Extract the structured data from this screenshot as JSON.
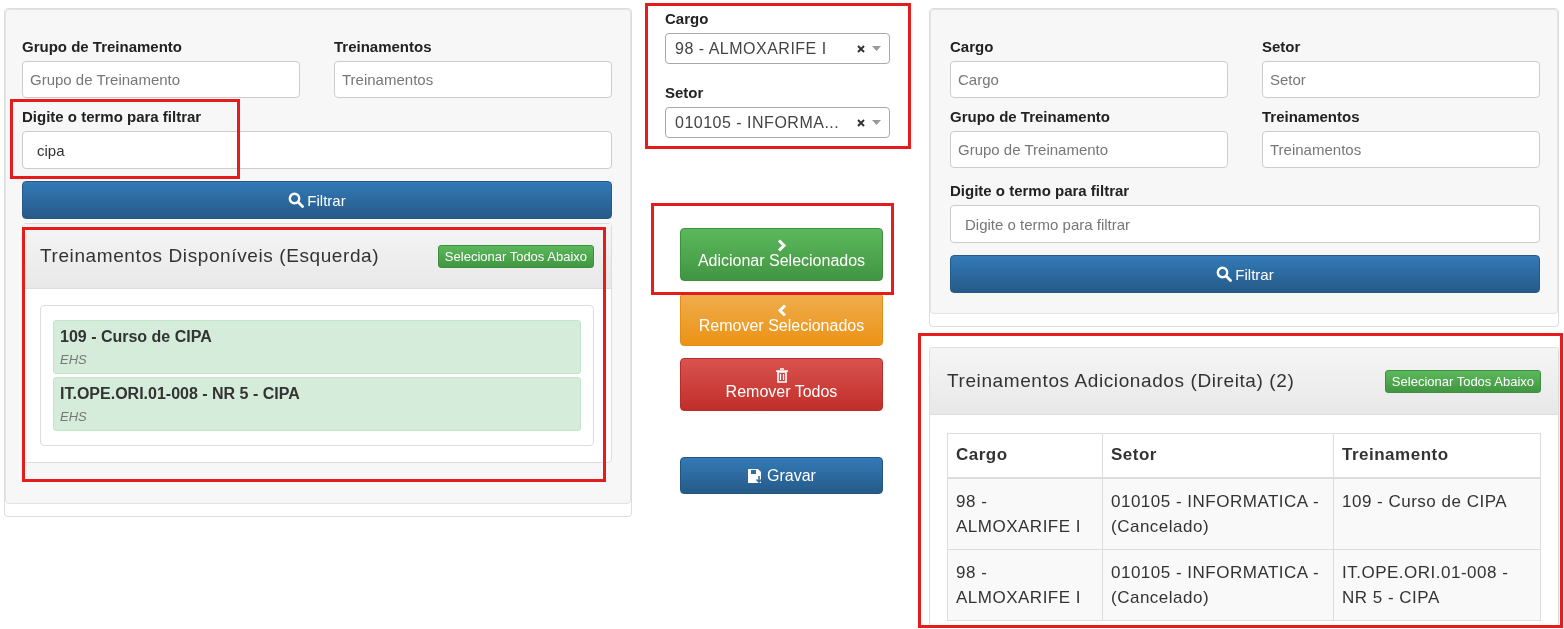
{
  "left_panel": {
    "fields": [
      {
        "label": "Grupo de Treinamento",
        "placeholder": "Grupo de Treinamento"
      },
      {
        "label": "Treinamentos",
        "placeholder": "Treinamentos"
      }
    ],
    "filter": {
      "label": "Digite o termo para filtrar",
      "value": "cipa"
    },
    "filter_button": "Filtrar",
    "list_panel": {
      "title": "Treinamentos Disponíveis (Esquerda)",
      "select_all_button": "Selecionar Todos Abaixo",
      "items": [
        {
          "title": "109 - Curso de CIPA",
          "group": "EHS"
        },
        {
          "title": "IT.OPE.ORI.01-008 - NR 5 - CIPA",
          "group": "EHS"
        }
      ]
    }
  },
  "middle": {
    "selects": [
      {
        "label": "Cargo",
        "value": "98 - ALMOXARIFE I"
      },
      {
        "label": "Setor",
        "value": "010105 - INFORMA..."
      }
    ],
    "buttons": [
      {
        "label": "Adicionar Selecionados",
        "kind": "add"
      },
      {
        "label": "Remover Selecionados",
        "kind": "remove"
      },
      {
        "label": "Remover Todos",
        "kind": "remove_all"
      },
      {
        "label": "Gravar",
        "kind": "save"
      }
    ]
  },
  "right_panel": {
    "fields": [
      {
        "label": "Cargo",
        "placeholder": "Cargo"
      },
      {
        "label": "Setor",
        "placeholder": "Setor"
      },
      {
        "label": "Grupo de Treinamento",
        "placeholder": "Grupo de Treinamento"
      },
      {
        "label": "Treinamentos",
        "placeholder": "Treinamentos"
      }
    ],
    "filter": {
      "label": "Digite o termo para filtrar",
      "placeholder": "Digite o termo para filtrar"
    },
    "filter_button": "Filtrar",
    "table_panel": {
      "title": "Treinamentos Adicionados (Direita) (2)",
      "select_all_button": "Selecionar Todos Abaixo",
      "columns": [
        "Cargo",
        "Setor",
        "Treinamento"
      ],
      "rows": [
        [
          "98 - ALMOXARIFE I",
          "010105 - INFORMATICA - (Cancelado)",
          "109 - Curso de CIPA"
        ],
        [
          "98 - ALMOXARIFE I",
          "010105 - INFORMATICA - (Cancelado)",
          "IT.OPE.ORI.01-008 - NR 5 - CIPA"
        ]
      ]
    }
  }
}
